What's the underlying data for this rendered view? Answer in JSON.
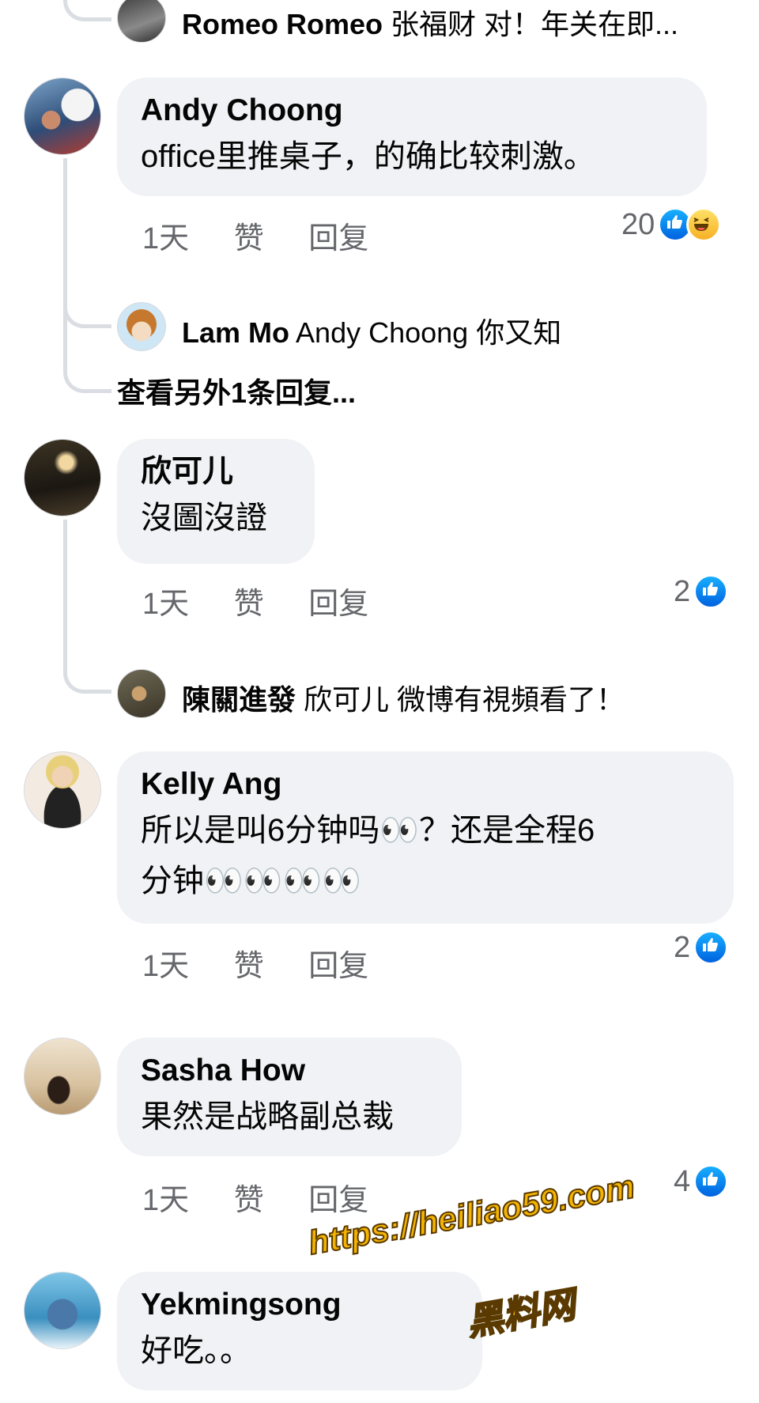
{
  "comments": [
    {
      "author": "Andy Choong",
      "text": "office里推桌子，的确比较刺激。",
      "time": "1天",
      "like_label": "赞",
      "reply_label": "回复",
      "reactions_count": "20",
      "reaction_icons": [
        "like-icon",
        "haha-icon"
      ]
    },
    {
      "author": "欣可儿",
      "text": "沒圖沒證",
      "time": "1天",
      "like_label": "赞",
      "reply_label": "回复",
      "reactions_count": "2",
      "reaction_icons": [
        "like-icon"
      ]
    },
    {
      "author": "Kelly Ang",
      "text_line1": "所以是叫6分钟吗👀？还是全程6",
      "text_line2": "分钟👀👀👀👀",
      "time": "1天",
      "like_label": "赞",
      "reply_label": "回复",
      "reactions_count": "2",
      "reaction_icons": [
        "like-icon"
      ]
    },
    {
      "author": "Sasha How",
      "text": "果然是战略副总裁",
      "time": "1天",
      "like_label": "赞",
      "reply_label": "回复",
      "reactions_count": "4",
      "reaction_icons": [
        "like-icon"
      ]
    },
    {
      "author": "Yekmingsong",
      "text": "好吃。。"
    }
  ],
  "replies": [
    {
      "author": "Romeo Romeo",
      "text": "张福财 对！年关在即..."
    },
    {
      "author": "Lam Mo",
      "text": "Andy Choong 你又知"
    },
    {
      "author": "陳關進發",
      "text": "欣可儿 微博有視頻看了！"
    }
  ],
  "view_more_replies": "查看另外1条回复...",
  "watermark": {
    "url": "https://heiliao59.com",
    "name": "黑料网"
  },
  "colors": {
    "bubble": "#f0f2f5",
    "meta_text": "#65676b",
    "like_blue": "#0866ff"
  }
}
